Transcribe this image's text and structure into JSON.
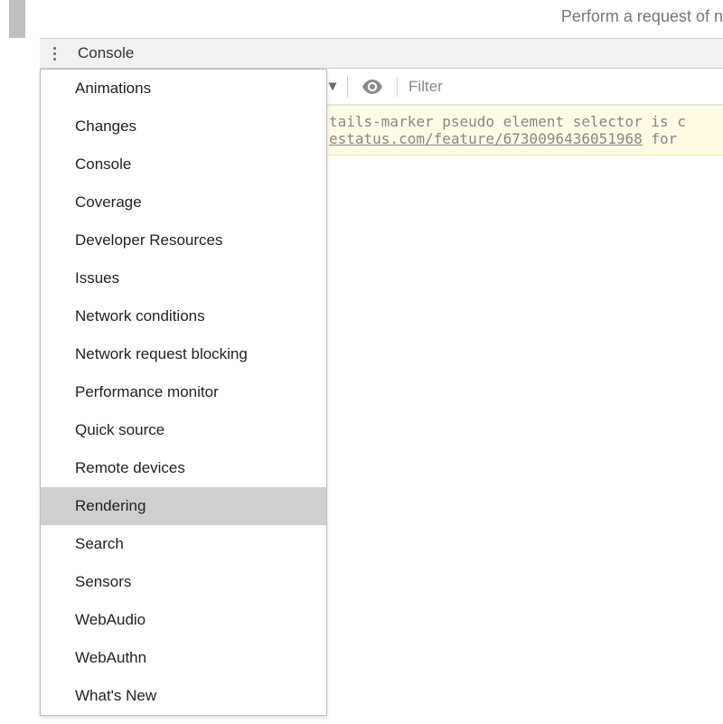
{
  "top_partial_text": "Perform a request of n",
  "console": {
    "tab_label": "Console"
  },
  "toolbar": {
    "filter_placeholder": "Filter"
  },
  "warning": {
    "line1": "tails-marker pseudo element selector is c",
    "link": "estatus.com/feature/6730096436051968",
    "line2_suffix": " for "
  },
  "dropdown": {
    "selected_index": 11,
    "items": [
      "Animations",
      "Changes",
      "Console",
      "Coverage",
      "Developer Resources",
      "Issues",
      "Network conditions",
      "Network request blocking",
      "Performance monitor",
      "Quick source",
      "Remote devices",
      "Rendering",
      "Search",
      "Sensors",
      "WebAudio",
      "WebAuthn",
      "What's New"
    ]
  }
}
